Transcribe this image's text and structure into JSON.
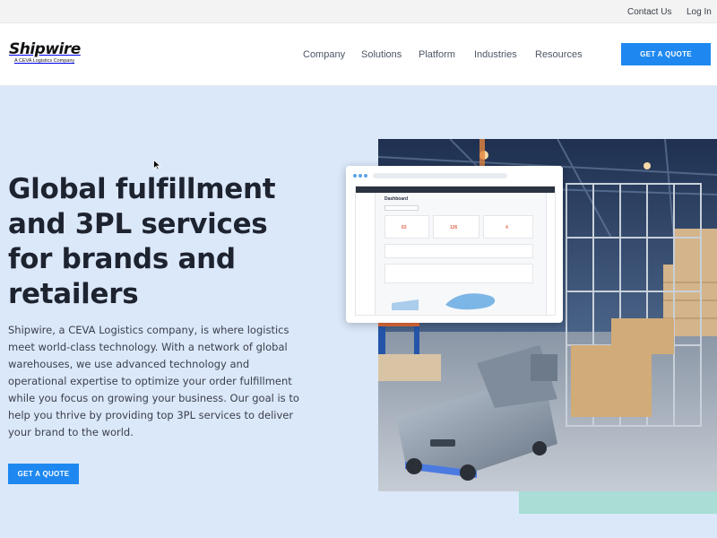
{
  "utility_bar": {
    "contact_label": "Contact Us",
    "login_label": "Log In"
  },
  "header": {
    "logo_text": "Shipwire",
    "logo_tagline": "A CEVA Logistics Company",
    "nav": {
      "company": "Company",
      "solutions": "Solutions",
      "platform": "Platform",
      "industries": "Industries",
      "resources": "Resources"
    },
    "cta_label": "GET A QUOTE"
  },
  "hero": {
    "title": "Global fulfillment and 3PL services for brands and retailers",
    "body": "Shipwire, a CEVA Logistics company, is where logistics meet world-class technology. With a network of global warehouses, we use advanced technology and operational expertise to optimize your order fulfillment while you focus on growing your business. Our goal is to help you thrive by providing top 3PL services to deliver your brand to the world.",
    "cta_label": "GET A QUOTE"
  },
  "dashboard_preview": {
    "title": "Dashboard",
    "values": [
      "63",
      "126",
      "4"
    ]
  },
  "colors": {
    "accent_blue": "#1e88f0",
    "hero_background": "#dbe8fa",
    "teal_accent": "#a9ddd6",
    "heading_text": "#1e2330"
  },
  "icons": {
    "cursor": "arrow-cursor-icon"
  }
}
